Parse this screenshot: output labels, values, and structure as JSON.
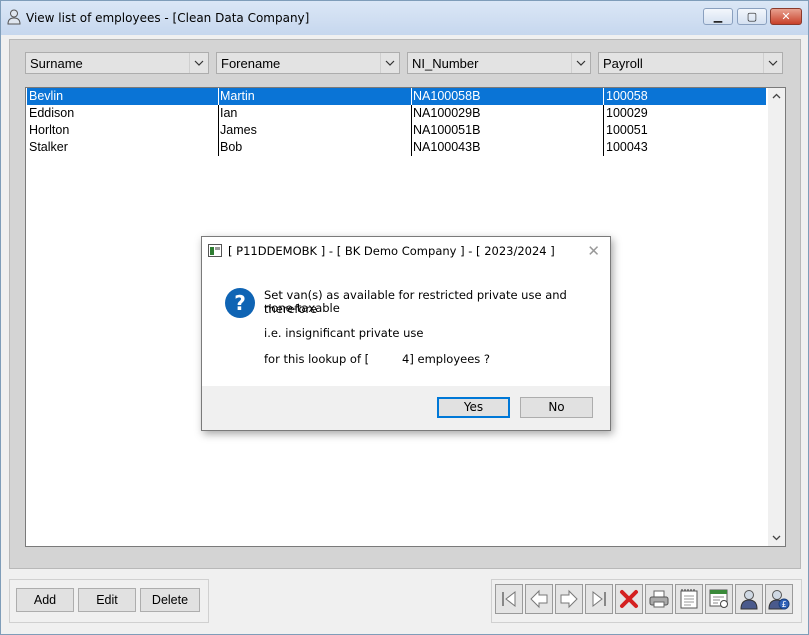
{
  "window": {
    "title": "View list of employees - [Clean Data Company]",
    "min_glyph": "▁",
    "max_glyph": "▢",
    "close_glyph": "✕"
  },
  "filters": [
    {
      "label": "Surname"
    },
    {
      "label": "Forename"
    },
    {
      "label": "NI_Number"
    },
    {
      "label": "Payroll"
    }
  ],
  "employees": [
    {
      "surname": "Bevlin",
      "forename": "Martin",
      "ni": "NA100058B",
      "payroll": "100058",
      "selected": true
    },
    {
      "surname": "Eddison",
      "forename": "Ian",
      "ni": "NA100029B",
      "payroll": "100029",
      "selected": false
    },
    {
      "surname": "Horlton",
      "forename": "James",
      "ni": "NA100051B",
      "payroll": "100051",
      "selected": false
    },
    {
      "surname": "Stalker",
      "forename": "Bob",
      "ni": "NA100043B",
      "payroll": "100043",
      "selected": false
    }
  ],
  "buttons": {
    "add": "Add",
    "edit": "Edit",
    "delete": "Delete"
  },
  "nav_icons": [
    "first-record-icon",
    "previous-record-icon",
    "next-record-icon",
    "last-record-icon",
    "delete-record-icon",
    "print-icon",
    "notes-icon",
    "report-icon",
    "employee-icon",
    "employee-pay-icon"
  ],
  "dialog": {
    "title": "[ P11DDEMOBK ] - [ BK Demo Company ] - [ 2023/2024 ]",
    "line1": "Set van(s) as available for restricted private use and therefore",
    "line2": "none-taxable",
    "line3": "i.e. insignificant private use",
    "line4": "for this lookup of [         4] employees ?",
    "yes": "Yes",
    "no": "No",
    "close_glyph": "✕"
  },
  "colors": {
    "selection": "#0a74d6",
    "question_icon": "#0f64b4"
  }
}
